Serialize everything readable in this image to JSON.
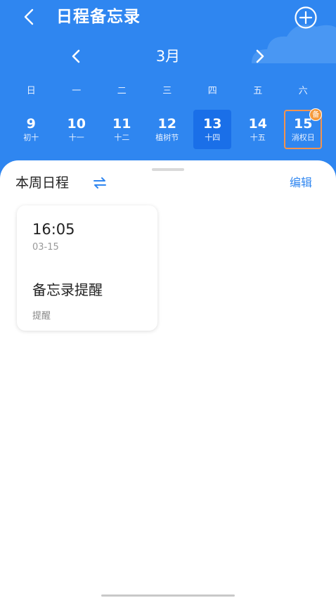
{
  "header": {
    "title": "日程备忘录",
    "month": "3月"
  },
  "weekdays": [
    "日",
    "一",
    "二",
    "三",
    "四",
    "五",
    "六"
  ],
  "dates": [
    {
      "day": "9",
      "lunar": "初十"
    },
    {
      "day": "10",
      "lunar": "十一"
    },
    {
      "day": "11",
      "lunar": "十二"
    },
    {
      "day": "12",
      "lunar": "植树节"
    },
    {
      "day": "13",
      "lunar": "十四",
      "selected": true
    },
    {
      "day": "14",
      "lunar": "十五"
    },
    {
      "day": "15",
      "lunar": "消权日",
      "badge": "备"
    }
  ],
  "section": {
    "title": "本周日程",
    "edit_label": "编辑"
  },
  "card": {
    "time": "16:05",
    "date": "03-15",
    "title": "备忘录提醒",
    "tag": "提醒"
  },
  "colors": {
    "header_bg": "#2f86f0",
    "selected_date_bg": "#1a6fe8",
    "marked_border": "#f3934f",
    "badge_bg": "#f59a3c",
    "accent": "#2f86f0"
  },
  "icons": {
    "back": "back-arrow-icon",
    "add": "plus-circle-icon",
    "prev": "chevron-left-icon",
    "next": "chevron-right-icon",
    "swap": "swap-arrows-icon"
  }
}
